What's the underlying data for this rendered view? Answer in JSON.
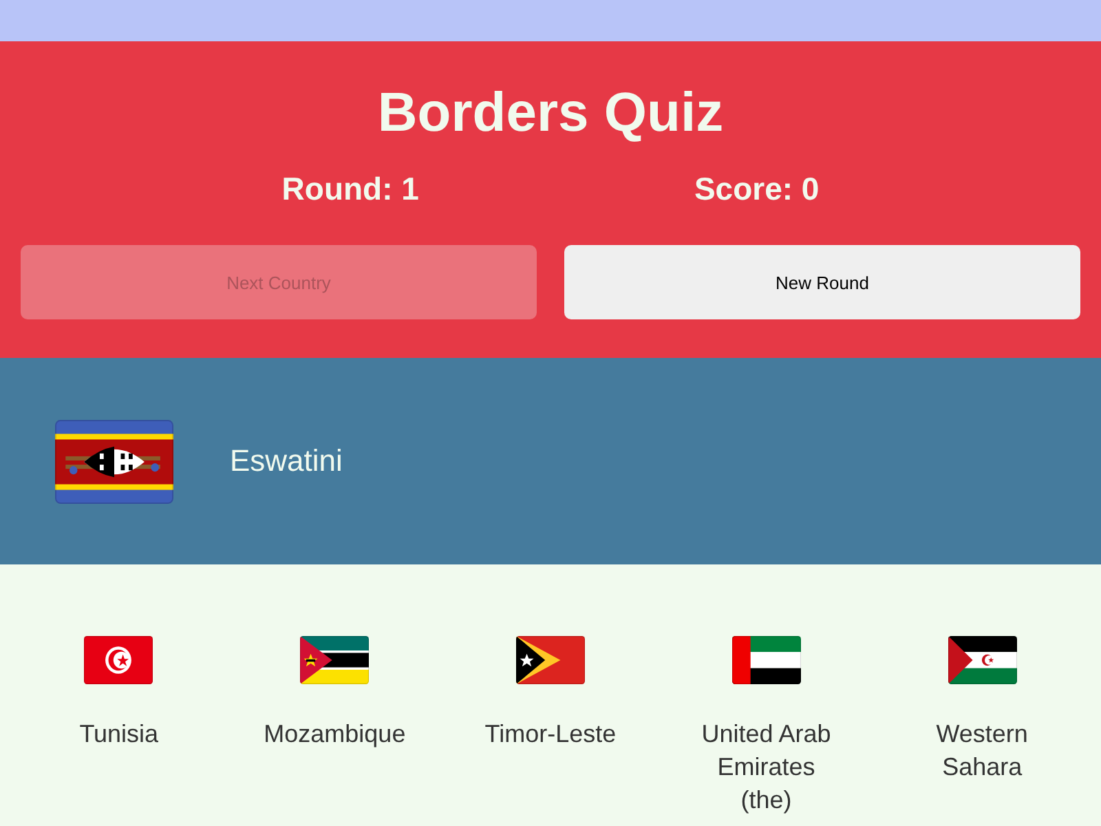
{
  "header": {
    "title": "Borders Quiz",
    "stats": [
      "Round: 1",
      "Score: 0"
    ],
    "buttons": [
      {
        "label": "Next Country",
        "disabled": true
      },
      {
        "label": "New Round",
        "disabled": false
      }
    ]
  },
  "country": {
    "name": "Eswatini",
    "kind": "eswatini"
  },
  "options": [
    {
      "name": "Tunisia",
      "kind": "tunisia"
    },
    {
      "name": "Mozambique",
      "kind": "mozambique"
    },
    {
      "name": "Timor-Leste",
      "kind": "timor"
    },
    {
      "name": "United Arab Emirates (the)",
      "kind": "emirates"
    },
    {
      "name": "Western Sahara",
      "kind": "sahara"
    }
  ]
}
